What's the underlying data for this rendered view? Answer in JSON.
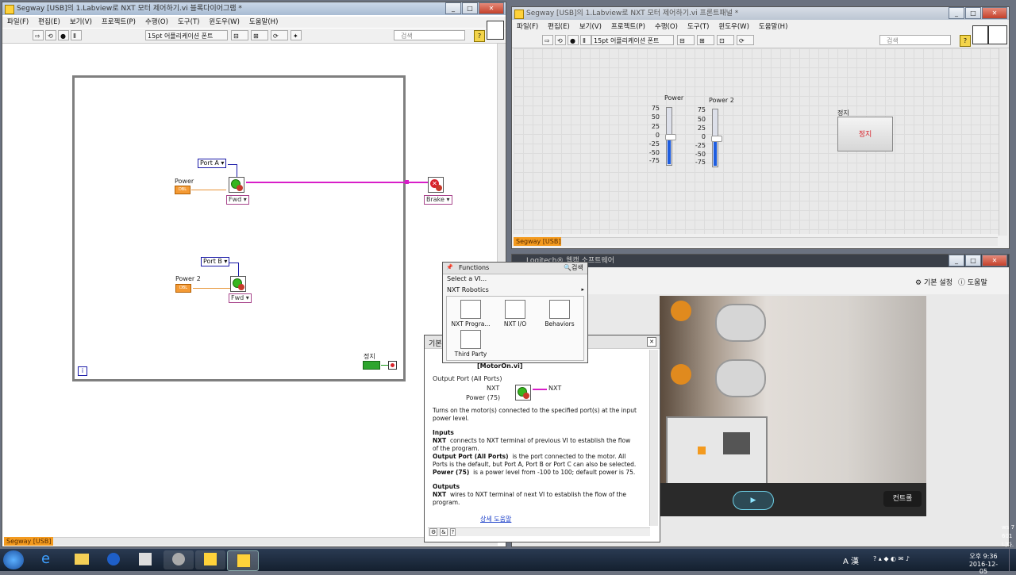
{
  "bd_window": {
    "title": "Segway [USB]의 1.Labview로 NXT 모터 제어하기.vi 블록다이어그램 *",
    "menus": [
      "파일(F)",
      "편집(E)",
      "보기(V)",
      "프로젝트(P)",
      "수행(O)",
      "도구(T)",
      "윈도우(W)",
      "도움말(H)"
    ],
    "font_select": "15pt 어플리케이션 폰트",
    "search_placeholder": "검색",
    "target_tag": "Segway [USB]",
    "port_a": "Port A",
    "port_b": "Port B",
    "power_label": "Power",
    "power2_label": "Power 2",
    "fwd1": "Fwd",
    "fwd2": "Fwd",
    "brake": "Brake",
    "stop_label": "정지",
    "info_icon": "i",
    "const_text": "DBL"
  },
  "fp_window": {
    "title": "Segway [USB]의 1.Labview로 NXT 모터 제어하기.vi 프론트패널 *",
    "menus": [
      "파일(F)",
      "편집(E)",
      "보기(V)",
      "프로젝트(P)",
      "수행(O)",
      "도구(T)",
      "윈도우(W)",
      "도움말(H)"
    ],
    "font_select": "15pt 어플리케이션 폰트",
    "search_placeholder": "검색",
    "target_tag": "Segway [USB]",
    "slider1_label": "Power",
    "slider2_label": "Power 2",
    "ticks": [
      "75",
      "50",
      "25",
      "0",
      "-25",
      "-50",
      "-75"
    ],
    "slider1_value": 0,
    "slider2_value": 0,
    "stop_caption": "정지",
    "stop_button": "정지"
  },
  "functions_palette": {
    "title": "Functions",
    "search": "검색",
    "select_vi": "Select a VI...",
    "category": "NXT Robotics",
    "items": [
      "NXT Progra...",
      "NXT I/O",
      "Behaviors",
      "Third Party"
    ]
  },
  "context_help": {
    "title": "기본",
    "vi_name": "[MotorOn.vi]",
    "output_port": "Output Port (All Ports)",
    "nxt_in": "NXT",
    "power_in": "Power (75)",
    "nxt_out": "NXT",
    "description": "Turns on the motor(s) connected to the specified port(s) at the input power level.",
    "inputs_heading": "Inputs",
    "nxt_term": "NXT",
    "nxt_desc": "connects to NXT terminal of previous VI to establish the flow of the program.",
    "port_term": "Output Port (All Ports)",
    "port_desc": "is the port connected to the motor. All Ports is the default, but Port A, Port B or Port C can also be selected.",
    "power_term": "Power (75)",
    "power_desc": "is a power level from -100 to 100; default power is 75.",
    "outputs_heading": "Outputs",
    "nxt_out_term": "NXT",
    "nxt_out_desc": "wires to NXT terminal of next VI to establish the flow of the program.",
    "detail_link": "상세 도움말"
  },
  "camera_window": {
    "title": "Logitech® 웹캠 소프트웨어",
    "settings": "기본 설정",
    "help": "도움말",
    "controls": "컨트롤"
  },
  "taskbar": {
    "time": "오후 9:36",
    "date": "2016-12-05",
    "ime": "A 漢",
    "side_text": [
      "ws 7",
      "601",
      "니다."
    ]
  }
}
